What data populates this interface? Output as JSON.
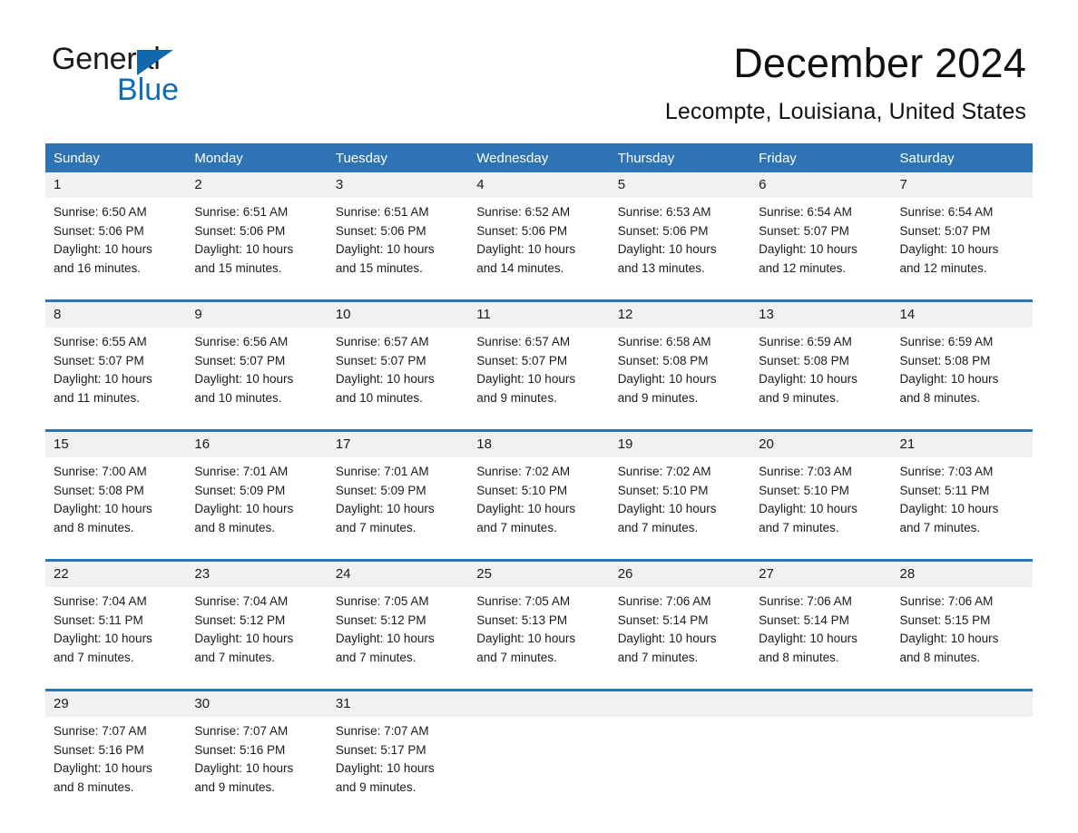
{
  "brand": {
    "name_part1": "General",
    "name_part2": "Blue",
    "accent_color": "#0f6cb4",
    "triangle_color": "#1268ac"
  },
  "header": {
    "title": "December 2024",
    "location": "Lecompte, Louisiana, United States"
  },
  "theme": {
    "header_blue": "#2e74b5",
    "daynum_band": "#f1f1f1",
    "text_color": "#1a1a1a"
  },
  "weekdays": [
    "Sunday",
    "Monday",
    "Tuesday",
    "Wednesday",
    "Thursday",
    "Friday",
    "Saturday"
  ],
  "weeks": [
    [
      {
        "day": "1",
        "sunrise": "Sunrise: 6:50 AM",
        "sunset": "Sunset: 5:06 PM",
        "daylight_line1": "Daylight: 10 hours",
        "daylight_line2": "and 16 minutes."
      },
      {
        "day": "2",
        "sunrise": "Sunrise: 6:51 AM",
        "sunset": "Sunset: 5:06 PM",
        "daylight_line1": "Daylight: 10 hours",
        "daylight_line2": "and 15 minutes."
      },
      {
        "day": "3",
        "sunrise": "Sunrise: 6:51 AM",
        "sunset": "Sunset: 5:06 PM",
        "daylight_line1": "Daylight: 10 hours",
        "daylight_line2": "and 15 minutes."
      },
      {
        "day": "4",
        "sunrise": "Sunrise: 6:52 AM",
        "sunset": "Sunset: 5:06 PM",
        "daylight_line1": "Daylight: 10 hours",
        "daylight_line2": "and 14 minutes."
      },
      {
        "day": "5",
        "sunrise": "Sunrise: 6:53 AM",
        "sunset": "Sunset: 5:06 PM",
        "daylight_line1": "Daylight: 10 hours",
        "daylight_line2": "and 13 minutes."
      },
      {
        "day": "6",
        "sunrise": "Sunrise: 6:54 AM",
        "sunset": "Sunset: 5:07 PM",
        "daylight_line1": "Daylight: 10 hours",
        "daylight_line2": "and 12 minutes."
      },
      {
        "day": "7",
        "sunrise": "Sunrise: 6:54 AM",
        "sunset": "Sunset: 5:07 PM",
        "daylight_line1": "Daylight: 10 hours",
        "daylight_line2": "and 12 minutes."
      }
    ],
    [
      {
        "day": "8",
        "sunrise": "Sunrise: 6:55 AM",
        "sunset": "Sunset: 5:07 PM",
        "daylight_line1": "Daylight: 10 hours",
        "daylight_line2": "and 11 minutes."
      },
      {
        "day": "9",
        "sunrise": "Sunrise: 6:56 AM",
        "sunset": "Sunset: 5:07 PM",
        "daylight_line1": "Daylight: 10 hours",
        "daylight_line2": "and 10 minutes."
      },
      {
        "day": "10",
        "sunrise": "Sunrise: 6:57 AM",
        "sunset": "Sunset: 5:07 PM",
        "daylight_line1": "Daylight: 10 hours",
        "daylight_line2": "and 10 minutes."
      },
      {
        "day": "11",
        "sunrise": "Sunrise: 6:57 AM",
        "sunset": "Sunset: 5:07 PM",
        "daylight_line1": "Daylight: 10 hours",
        "daylight_line2": "and 9 minutes."
      },
      {
        "day": "12",
        "sunrise": "Sunrise: 6:58 AM",
        "sunset": "Sunset: 5:08 PM",
        "daylight_line1": "Daylight: 10 hours",
        "daylight_line2": "and 9 minutes."
      },
      {
        "day": "13",
        "sunrise": "Sunrise: 6:59 AM",
        "sunset": "Sunset: 5:08 PM",
        "daylight_line1": "Daylight: 10 hours",
        "daylight_line2": "and 9 minutes."
      },
      {
        "day": "14",
        "sunrise": "Sunrise: 6:59 AM",
        "sunset": "Sunset: 5:08 PM",
        "daylight_line1": "Daylight: 10 hours",
        "daylight_line2": "and 8 minutes."
      }
    ],
    [
      {
        "day": "15",
        "sunrise": "Sunrise: 7:00 AM",
        "sunset": "Sunset: 5:08 PM",
        "daylight_line1": "Daylight: 10 hours",
        "daylight_line2": "and 8 minutes."
      },
      {
        "day": "16",
        "sunrise": "Sunrise: 7:01 AM",
        "sunset": "Sunset: 5:09 PM",
        "daylight_line1": "Daylight: 10 hours",
        "daylight_line2": "and 8 minutes."
      },
      {
        "day": "17",
        "sunrise": "Sunrise: 7:01 AM",
        "sunset": "Sunset: 5:09 PM",
        "daylight_line1": "Daylight: 10 hours",
        "daylight_line2": "and 7 minutes."
      },
      {
        "day": "18",
        "sunrise": "Sunrise: 7:02 AM",
        "sunset": "Sunset: 5:10 PM",
        "daylight_line1": "Daylight: 10 hours",
        "daylight_line2": "and 7 minutes."
      },
      {
        "day": "19",
        "sunrise": "Sunrise: 7:02 AM",
        "sunset": "Sunset: 5:10 PM",
        "daylight_line1": "Daylight: 10 hours",
        "daylight_line2": "and 7 minutes."
      },
      {
        "day": "20",
        "sunrise": "Sunrise: 7:03 AM",
        "sunset": "Sunset: 5:10 PM",
        "daylight_line1": "Daylight: 10 hours",
        "daylight_line2": "and 7 minutes."
      },
      {
        "day": "21",
        "sunrise": "Sunrise: 7:03 AM",
        "sunset": "Sunset: 5:11 PM",
        "daylight_line1": "Daylight: 10 hours",
        "daylight_line2": "and 7 minutes."
      }
    ],
    [
      {
        "day": "22",
        "sunrise": "Sunrise: 7:04 AM",
        "sunset": "Sunset: 5:11 PM",
        "daylight_line1": "Daylight: 10 hours",
        "daylight_line2": "and 7 minutes."
      },
      {
        "day": "23",
        "sunrise": "Sunrise: 7:04 AM",
        "sunset": "Sunset: 5:12 PM",
        "daylight_line1": "Daylight: 10 hours",
        "daylight_line2": "and 7 minutes."
      },
      {
        "day": "24",
        "sunrise": "Sunrise: 7:05 AM",
        "sunset": "Sunset: 5:12 PM",
        "daylight_line1": "Daylight: 10 hours",
        "daylight_line2": "and 7 minutes."
      },
      {
        "day": "25",
        "sunrise": "Sunrise: 7:05 AM",
        "sunset": "Sunset: 5:13 PM",
        "daylight_line1": "Daylight: 10 hours",
        "daylight_line2": "and 7 minutes."
      },
      {
        "day": "26",
        "sunrise": "Sunrise: 7:06 AM",
        "sunset": "Sunset: 5:14 PM",
        "daylight_line1": "Daylight: 10 hours",
        "daylight_line2": "and 7 minutes."
      },
      {
        "day": "27",
        "sunrise": "Sunrise: 7:06 AM",
        "sunset": "Sunset: 5:14 PM",
        "daylight_line1": "Daylight: 10 hours",
        "daylight_line2": "and 8 minutes."
      },
      {
        "day": "28",
        "sunrise": "Sunrise: 7:06 AM",
        "sunset": "Sunset: 5:15 PM",
        "daylight_line1": "Daylight: 10 hours",
        "daylight_line2": "and 8 minutes."
      }
    ],
    [
      {
        "day": "29",
        "sunrise": "Sunrise: 7:07 AM",
        "sunset": "Sunset: 5:16 PM",
        "daylight_line1": "Daylight: 10 hours",
        "daylight_line2": "and 8 minutes."
      },
      {
        "day": "30",
        "sunrise": "Sunrise: 7:07 AM",
        "sunset": "Sunset: 5:16 PM",
        "daylight_line1": "Daylight: 10 hours",
        "daylight_line2": "and 9 minutes."
      },
      {
        "day": "31",
        "sunrise": "Sunrise: 7:07 AM",
        "sunset": "Sunset: 5:17 PM",
        "daylight_line1": "Daylight: 10 hours",
        "daylight_line2": "and 9 minutes."
      },
      {
        "day": "",
        "sunrise": "",
        "sunset": "",
        "daylight_line1": "",
        "daylight_line2": ""
      },
      {
        "day": "",
        "sunrise": "",
        "sunset": "",
        "daylight_line1": "",
        "daylight_line2": ""
      },
      {
        "day": "",
        "sunrise": "",
        "sunset": "",
        "daylight_line1": "",
        "daylight_line2": ""
      },
      {
        "day": "",
        "sunrise": "",
        "sunset": "",
        "daylight_line1": "",
        "daylight_line2": ""
      }
    ]
  ]
}
